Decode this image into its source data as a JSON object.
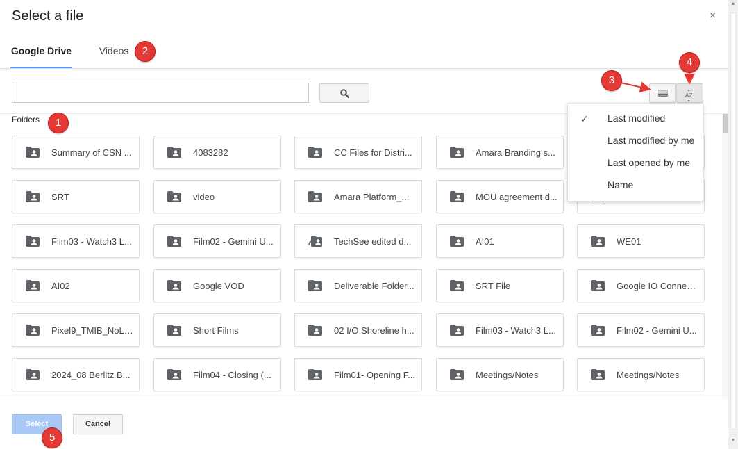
{
  "dialog": {
    "title": "Select a file",
    "close_icon": "×"
  },
  "tabs": [
    {
      "label": "Google Drive",
      "active": true
    },
    {
      "label": "Videos",
      "active": false
    }
  ],
  "search": {
    "value": "",
    "placeholder": ""
  },
  "folders_label": "Folders",
  "folders": [
    {
      "name": "Summary of CSN ...",
      "icon": "folder-shared-icon"
    },
    {
      "name": "4083282",
      "icon": "folder-shared-icon"
    },
    {
      "name": "CC Files for Distri...",
      "icon": "folder-shared-icon"
    },
    {
      "name": "Amara Branding s...",
      "icon": "folder-shared-icon"
    },
    {
      "name": "",
      "icon": "folder-shared-icon"
    },
    {
      "name": "SRT",
      "icon": "folder-shared-icon"
    },
    {
      "name": "video",
      "icon": "folder-shared-icon"
    },
    {
      "name": "Amara Platform_...",
      "icon": "folder-shared-icon"
    },
    {
      "name": "MOU agreement d...",
      "icon": "folder-shared-icon"
    },
    {
      "name": "",
      "icon": "folder-shared-icon"
    },
    {
      "name": "Film03 - Watch3 L...",
      "icon": "folder-shared-icon"
    },
    {
      "name": "Film02 - Gemini U...",
      "icon": "folder-shared-icon"
    },
    {
      "name": "TechSee edited d...",
      "icon": "folder-shortcut-icon"
    },
    {
      "name": "AI01",
      "icon": "folder-shared-icon"
    },
    {
      "name": "WE01",
      "icon": "folder-shared-icon"
    },
    {
      "name": "AI02",
      "icon": "folder-shared-icon"
    },
    {
      "name": "Google VOD",
      "icon": "folder-shared-icon"
    },
    {
      "name": "Deliverable Folder...",
      "icon": "folder-shared-icon"
    },
    {
      "name": "SRT File",
      "icon": "folder-shared-icon"
    },
    {
      "name": "Google IO Connec...",
      "icon": "folder-shared-icon"
    },
    {
      "name": "Pixel9_TMIB_NoLi...",
      "icon": "folder-shared-icon"
    },
    {
      "name": "Short Films",
      "icon": "folder-shared-icon"
    },
    {
      "name": "02 I/O Shoreline h...",
      "icon": "folder-shared-icon"
    },
    {
      "name": "Film03 - Watch3 L...",
      "icon": "folder-shared-icon"
    },
    {
      "name": "Film02 - Gemini U...",
      "icon": "folder-shared-icon"
    },
    {
      "name": "2024_08 Berlitz B...",
      "icon": "folder-shared-icon"
    },
    {
      "name": "Film04 - Closing (...",
      "icon": "folder-shared-icon"
    },
    {
      "name": "Film01- Opening F...",
      "icon": "folder-shared-icon"
    },
    {
      "name": "Meetings/Notes",
      "icon": "folder-shared-icon"
    },
    {
      "name": "Meetings/Notes",
      "icon": "folder-shared-icon"
    }
  ],
  "sort_menu": {
    "check_glyph": "✓",
    "items": [
      {
        "label": "Last modified",
        "checked": true
      },
      {
        "label": "Last modified by me",
        "checked": false
      },
      {
        "label": "Last opened by me",
        "checked": false
      },
      {
        "label": "Name",
        "checked": false
      }
    ]
  },
  "toolbar": {
    "list_view_icon": "list-view-icon",
    "sort_icon": "sort-az-icon",
    "sort_glyph_top": "A",
    "sort_glyph_bottom": "Z"
  },
  "footer": {
    "select_label": "Select",
    "cancel_label": "Cancel"
  },
  "annotations": [
    "1",
    "2",
    "3",
    "4",
    "5"
  ],
  "colors": {
    "accent": "#4d90fe",
    "select_disabled": "#a9c8f5",
    "annotation": "#e53935"
  }
}
